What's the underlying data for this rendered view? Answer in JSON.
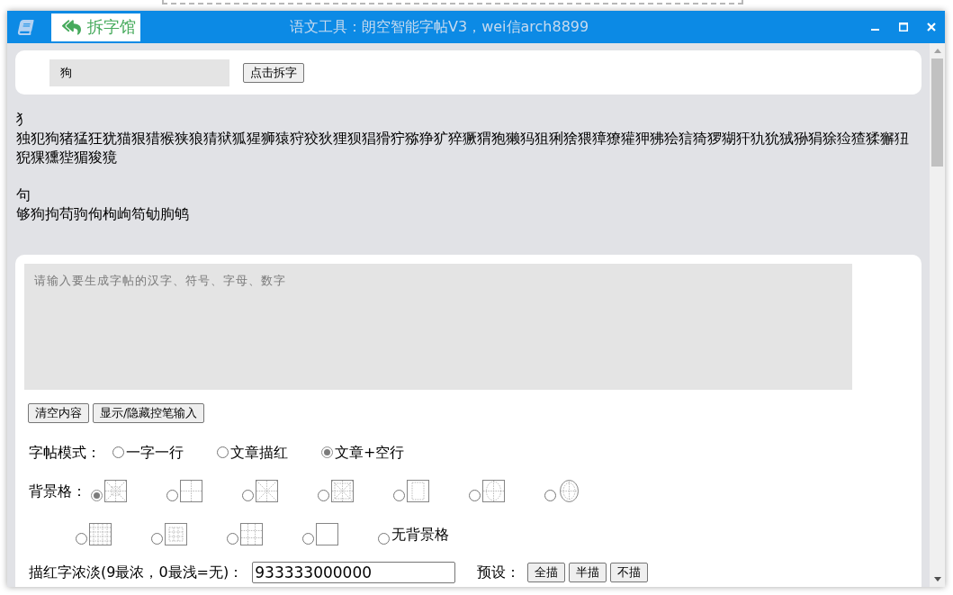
{
  "window": {
    "title": "语文工具：朗空智能字帖V3，wei信arch8899",
    "app_button": "拆字馆"
  },
  "split_form": {
    "input_value": "狗",
    "button": "点击拆字"
  },
  "split_results": [
    {
      "component": "犭",
      "characters": "独犯狗猪猛狂犹猫狠猎猴狭狼猜狱狐猩狮猿狩狡狄狸狈猖猾狞猕狰犷猝獗猬狍獭犸狙猁猞猥獐獠獾狎狒狯狺猗猡猢犴犰狁狨狲狷狳猃猹猱獬狃猊猓獯狴猸狻獍"
    },
    {
      "component": "句",
      "characters": "够狗拘苟驹佝枸岣笱劬朐鸲"
    }
  ],
  "copybook": {
    "text_input": {
      "placeholder": "请输入要生成字帖的汉字、符号、字母、数字"
    },
    "buttons": [
      "清空内容",
      "显示/隐藏控笔输入"
    ],
    "mode": {
      "label": "字帖模式：",
      "options": [
        {
          "label": "一字一行",
          "selected": false
        },
        {
          "label": "文章描红",
          "selected": false
        },
        {
          "label": "文章+空行",
          "selected": true
        }
      ]
    },
    "background_grid": {
      "label": "背景格：",
      "options": [
        {
          "kind": "mi_hui",
          "selected": true
        },
        {
          "kind": "tian",
          "selected": false
        },
        {
          "kind": "mi",
          "selected": false
        },
        {
          "kind": "mi_hui_double",
          "selected": false
        },
        {
          "kind": "inner_rect",
          "selected": false
        },
        {
          "kind": "oval_tian",
          "selected": false
        },
        {
          "kind": "ellipse",
          "selected": false
        },
        {
          "kind": "fine_grid",
          "selected": false
        },
        {
          "kind": "hui_grid",
          "selected": false
        },
        {
          "kind": "tian_grid",
          "selected": false
        },
        {
          "kind": "plain",
          "selected": false
        },
        {
          "kind": "none",
          "label": "无背景格",
          "selected": false
        }
      ]
    },
    "trace_shade": {
      "label": "描红字浓淡(9最浓，0最浅=无)：",
      "value": "933333000000"
    },
    "presets": {
      "label": "预设：",
      "buttons": [
        "全描",
        "半描",
        "不描"
      ]
    }
  }
}
